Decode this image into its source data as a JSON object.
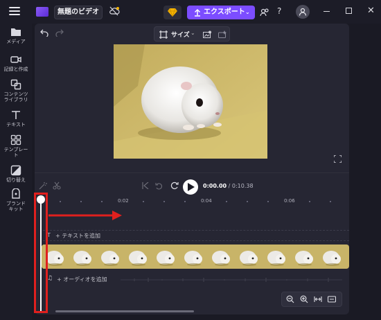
{
  "app": {
    "project_title": "無題のビデオ",
    "export_label": "エクスポート",
    "export_chevron": "⌄",
    "help_label": "?"
  },
  "sidebar": {
    "items": [
      {
        "label": "メディア",
        "icon": "folder-icon"
      },
      {
        "label": "記録と作成",
        "icon": "camera-icon"
      },
      {
        "label": "コンテンツ\nライブラリ",
        "icon": "library-icon"
      },
      {
        "label": "テキスト",
        "icon": "text-icon"
      },
      {
        "label": "テンプレー\nト",
        "icon": "templates-icon"
      },
      {
        "label": "切り替え",
        "icon": "transitions-icon"
      },
      {
        "label": "ブランド\nキット",
        "icon": "brand-kit-icon"
      }
    ]
  },
  "preview_toolbar": {
    "size_label": "サイズ",
    "size_chevron": "⌄"
  },
  "playback": {
    "current_time": "0:00.00",
    "separator": " / ",
    "total_time": "0:10.38"
  },
  "timeline": {
    "tick_labels": [
      "0:02",
      "0:04",
      "0:06"
    ],
    "text_track_icon": "T",
    "text_track_label": "+ テキストを追加",
    "audio_track_icon": "♫",
    "audio_track_label": "+ オーディオを追加",
    "thumbnail_count": 11
  },
  "colors": {
    "accent": "#7c4dff",
    "annotation_red": "#e0201e",
    "background": "#1a1a24",
    "panel": "#262633",
    "premium_gem": "#f5b400"
  }
}
